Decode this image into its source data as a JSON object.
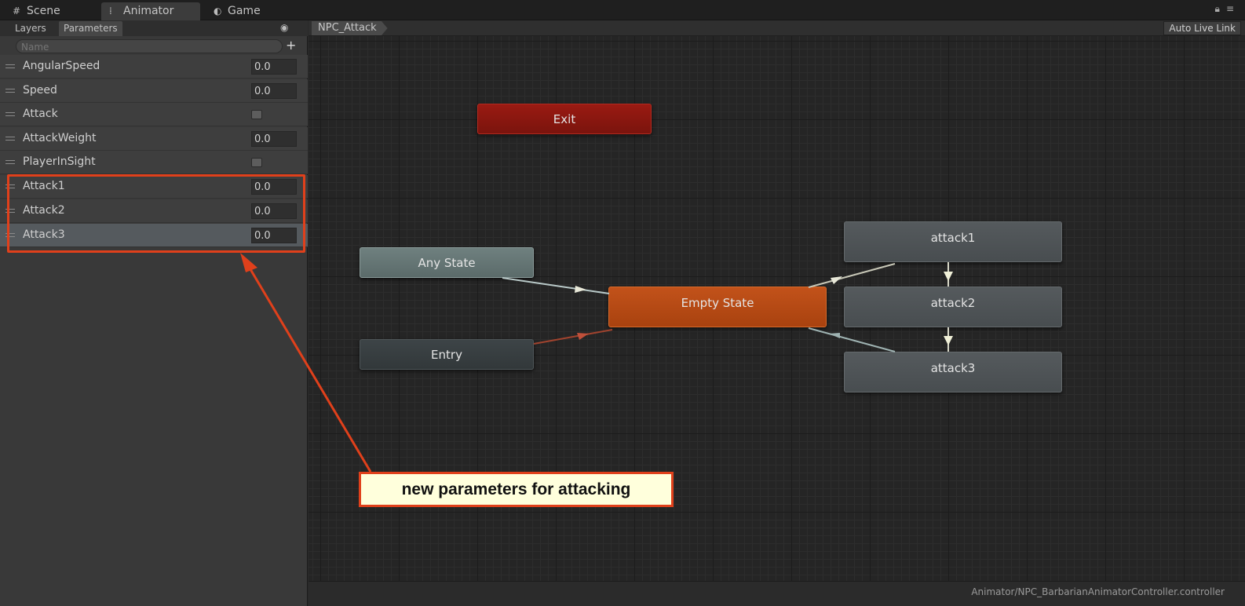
{
  "tabs": [
    {
      "label": "Scene",
      "icon": "grid-icon"
    },
    {
      "label": "Animator",
      "icon": "animator-icon"
    },
    {
      "label": "Game",
      "icon": "game-icon"
    }
  ],
  "active_tab": "Animator",
  "left_panel": {
    "subtabs": [
      "Layers",
      "Parameters"
    ],
    "active_subtab": "Parameters",
    "search": {
      "placeholder": "Name",
      "value": ""
    },
    "parameters": [
      {
        "name": "AngularSpeed",
        "type": "float",
        "value": "0.0"
      },
      {
        "name": "Speed",
        "type": "float",
        "value": "0.0"
      },
      {
        "name": "Attack",
        "type": "bool",
        "value": false
      },
      {
        "name": "AttackWeight",
        "type": "float",
        "value": "0.0"
      },
      {
        "name": "PlayerInSight",
        "type": "bool",
        "value": false
      },
      {
        "name": "Attack1",
        "type": "float",
        "value": "0.0"
      },
      {
        "name": "Attack2",
        "type": "float",
        "value": "0.0"
      },
      {
        "name": "Attack3",
        "type": "float",
        "value": "0.0",
        "selected": true
      }
    ]
  },
  "graph": {
    "breadcrumb": "NPC_Attack",
    "auto_live_link": "Auto Live Link",
    "nodes": {
      "exit": "Exit",
      "any_state": "Any State",
      "entry": "Entry",
      "empty_state": "Empty State",
      "attack1": "attack1",
      "attack2": "attack2",
      "attack3": "attack3"
    }
  },
  "status_bar": {
    "path": "Animator/NPC_BarbarianAnimatorController.controller"
  },
  "callout": {
    "text": "new parameters for attacking"
  },
  "colors": {
    "highlight": "#e0401b",
    "exit_node": "#9a1a12",
    "empty_state_node": "#c2521a",
    "any_state_node": "#6f807f",
    "callout_bg": "#ffffdc"
  }
}
